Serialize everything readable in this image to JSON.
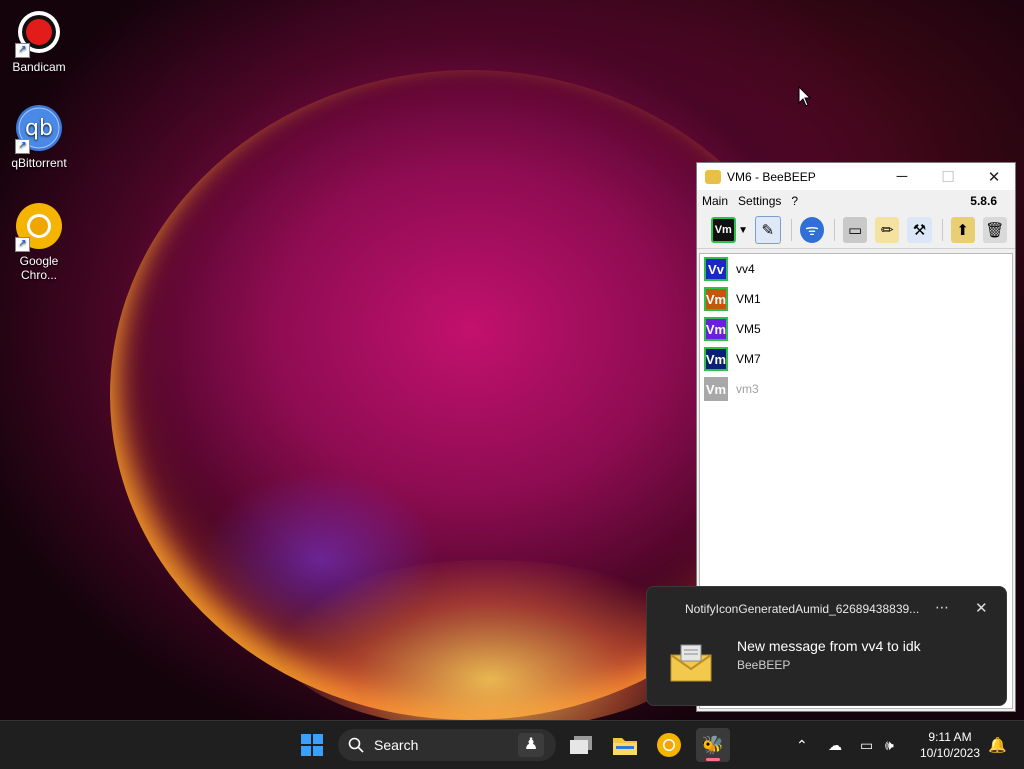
{
  "desktop": {
    "icons": [
      {
        "label": "Bandicam"
      },
      {
        "label": "qBittorrent"
      },
      {
        "label": "Google Chro..."
      }
    ]
  },
  "window": {
    "title": "VM6 - BeeBEEP",
    "version": "5.8.6",
    "menu": [
      "Main",
      "Settings",
      "?"
    ],
    "toolbar_status_badge": "Vm",
    "users": [
      {
        "badge": "Vv",
        "name": "vv4",
        "color": "#1c27c8",
        "online": true
      },
      {
        "badge": "Vm",
        "name": "VM1",
        "color": "#c4560e",
        "online": true
      },
      {
        "badge": "Vm",
        "name": "VM5",
        "color": "#6a1fe0",
        "online": true
      },
      {
        "badge": "Vm",
        "name": "VM7",
        "color": "#0b1f74",
        "online": true
      },
      {
        "badge": "Vm",
        "name": "vm3",
        "color": "#a8a8a8",
        "online": false
      }
    ]
  },
  "notification": {
    "source": "NotifyIconGeneratedAumid_62689438839...",
    "more_label": "⋯",
    "close_label": "✕",
    "message": "New message from vv4 to idk",
    "app": "BeeBEEP"
  },
  "taskbar": {
    "search_placeholder": "Search",
    "time": "9:11 AM",
    "date": "10/10/2023"
  }
}
